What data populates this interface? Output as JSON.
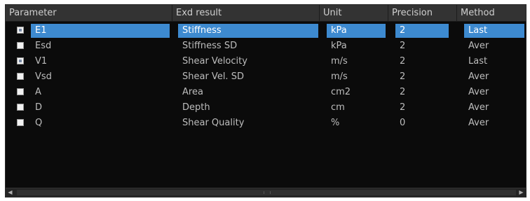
{
  "columns": [
    "Parameter",
    "Exd result",
    "Unit",
    "Precision",
    "Method"
  ],
  "rows": [
    {
      "checked": true,
      "selected": true,
      "parameter": "E1",
      "result": "Stiffness",
      "unit": "kPa",
      "precision": "2",
      "method": "Last"
    },
    {
      "checked": false,
      "selected": false,
      "parameter": "Esd",
      "result": "Stiffness SD",
      "unit": "kPa",
      "precision": "2",
      "method": "Aver"
    },
    {
      "checked": true,
      "selected": false,
      "parameter": "V1",
      "result": "Shear Velocity",
      "unit": "m/s",
      "precision": "2",
      "method": "Last"
    },
    {
      "checked": false,
      "selected": false,
      "parameter": "Vsd",
      "result": "Shear Vel. SD",
      "unit": "m/s",
      "precision": "2",
      "method": "Aver"
    },
    {
      "checked": false,
      "selected": false,
      "parameter": "A",
      "result": "Area",
      "unit": "cm2",
      "precision": "2",
      "method": "Aver"
    },
    {
      "checked": false,
      "selected": false,
      "parameter": "D",
      "result": "Depth",
      "unit": "cm",
      "precision": "2",
      "method": "Aver"
    },
    {
      "checked": false,
      "selected": false,
      "parameter": "Q",
      "result": "Shear Quality",
      "unit": "%",
      "precision": "0",
      "method": "Aver"
    }
  ],
  "scrollbar": {
    "left_arrow_icon": "triangle-left-icon",
    "right_arrow_icon": "triangle-right-icon",
    "left_arrow_glyph": "◀",
    "right_arrow_glyph": "▶"
  },
  "colors": {
    "selection": "#3d8ad0",
    "background": "#0b0b0b",
    "header": "#333333"
  }
}
